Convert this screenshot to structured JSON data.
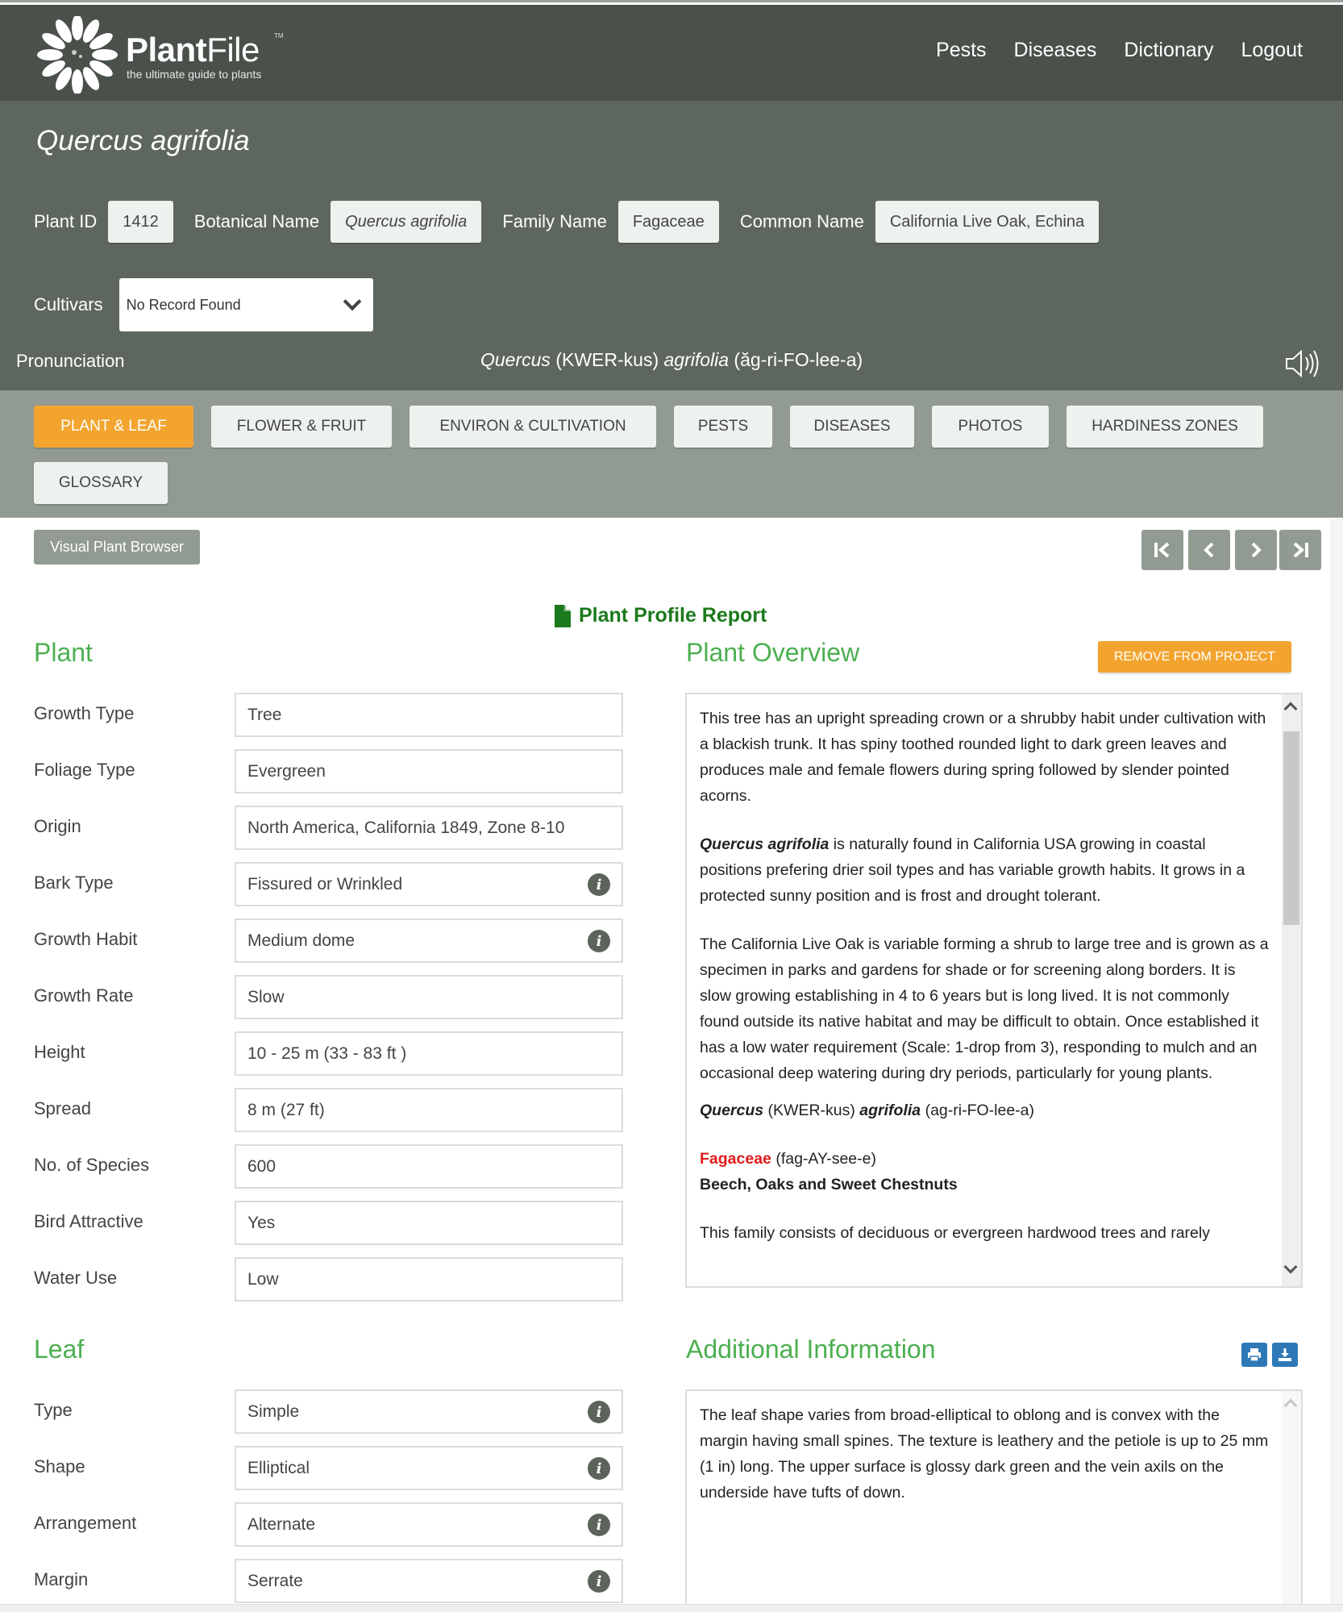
{
  "brand": {
    "name_bold": "Plant",
    "name_light": "File",
    "trademark": "TM",
    "tagline": "the ultimate guide to plants"
  },
  "topnav": [
    "Pests",
    "Diseases",
    "Dictionary",
    "Logout"
  ],
  "plant": {
    "title": "Quercus agrifolia",
    "fields": [
      {
        "label": "Plant ID",
        "value": "1412"
      },
      {
        "label": "Botanical Name",
        "value": "Quercus agrifolia"
      },
      {
        "label": "Family Name",
        "value": "Fagaceae"
      },
      {
        "label": "Common Name",
        "value": "California Live Oak, Echina"
      }
    ],
    "cultivars_label": "Cultivars",
    "cultivars_selected": "No Record Found",
    "pronunciation_label": "Pronunciation",
    "pronunciation": {
      "genus": "Quercus",
      "genus_phon": " (KWER-kus) ",
      "species": "agrifolia",
      "species_phon": " (ăg-ri-FO-lee-a)"
    }
  },
  "tabs": [
    {
      "label": "PLANT & LEAF",
      "active": true
    },
    {
      "label": "FLOWER & FRUIT",
      "active": false
    },
    {
      "label": "ENVIRON & CULTIVATION",
      "active": false
    },
    {
      "label": "PESTS",
      "active": false
    },
    {
      "label": "DISEASES",
      "active": false
    },
    {
      "label": "PHOTOS",
      "active": false
    },
    {
      "label": "HARDINESS ZONES",
      "active": false
    },
    {
      "label": "GLOSSARY",
      "active": false
    }
  ],
  "toolbar": {
    "visual_plant_browser": "Visual Plant Browser",
    "nav_buttons": [
      "first-record",
      "previous-record",
      "next-record",
      "last-record"
    ]
  },
  "report_link": "Plant Profile Report",
  "plant_section": {
    "title": "Plant",
    "rows": [
      {
        "label": "Growth Type",
        "value": "Tree",
        "info": false
      },
      {
        "label": "Foliage Type",
        "value": "Evergreen",
        "info": false
      },
      {
        "label": "Origin",
        "value": "North America, California 1849, Zone 8-10",
        "info": false
      },
      {
        "label": "Bark Type",
        "value": "Fissured or Wrinkled",
        "info": true
      },
      {
        "label": "Growth Habit",
        "value": "Medium dome",
        "info": true
      },
      {
        "label": "Growth Rate",
        "value": "Slow",
        "info": false
      },
      {
        "label": "Height",
        "value": "10 - 25 m (33 - 83 ft )",
        "info": false
      },
      {
        "label": "Spread",
        "value": "8 m (27 ft)",
        "info": false
      },
      {
        "label": "No. of Species",
        "value": "600",
        "info": false
      },
      {
        "label": "Bird Attractive",
        "value": "Yes",
        "info": false
      },
      {
        "label": "Water Use",
        "value": "Low",
        "info": false
      }
    ]
  },
  "leaf_section": {
    "title": "Leaf",
    "rows": [
      {
        "label": "Type",
        "value": "Simple",
        "info": true
      },
      {
        "label": "Shape",
        "value": "Elliptical",
        "info": true
      },
      {
        "label": "Arrangement",
        "value": "Alternate",
        "info": true
      },
      {
        "label": "Margin",
        "value": "Serrate",
        "info": true
      }
    ]
  },
  "overview": {
    "title": "Plant Overview",
    "remove_button": "REMOVE FROM PROJECT",
    "p1": "This tree has an upright spreading crown or a shrubby habit under cultivation with a blackish trunk. It has spiny toothed rounded light to dark green leaves and produces male and female flowers during spring followed by slender pointed acorns.",
    "p2_name": "Quercus agrifolia",
    "p2_rest": " is naturally found in California USA growing in coastal positions prefering drier soil types and has variable growth habits. It grows in a protected sunny position and is frost and drought tolerant.",
    "p3": "The California Live Oak is variable forming a shrub to large tree and is grown as a specimen in parks and gardens for shade or for screening along borders. It is slow growing establishing in 4 to 6 years but is long lived. It is not commonly found outside its native habitat and may be difficult to obtain. Once established it has a low water requirement (Scale: 1-drop from 3), responding to mulch and an occasional deep watering during dry periods, particularly for young plants.",
    "p4_genus": "Quercus",
    "p4_genus_phon": " (KWER-kus) ",
    "p4_species": "agrifolia",
    "p4_species_phon": " (ag-ri-FO-lee-a)",
    "family": "Fagaceae",
    "family_phon": " (fag-AY-see-e)",
    "family_common": "Beech, Oaks and Sweet Chestnuts",
    "p6": "This family consists of deciduous or evergreen hardwood trees and rarely"
  },
  "additional": {
    "title": "Additional Information",
    "text": "The leaf shape varies from broad-elliptical to oblong and is convex with the margin having small spines. The texture is leathery and the petiole is up to 25 mm (1 in) long. The upper surface is glossy dark green and the vein axils on the underside have tufts of down."
  },
  "colors": {
    "header_dark": "#4a504a",
    "header_mid": "#5e675e",
    "tabs_bg": "#919b91",
    "accent_orange": "#f3a42f",
    "section_green": "#4caf50",
    "report_green": "#1c7a1c",
    "icon_blue": "#2f78b7",
    "family_red": "#e01b1b"
  }
}
